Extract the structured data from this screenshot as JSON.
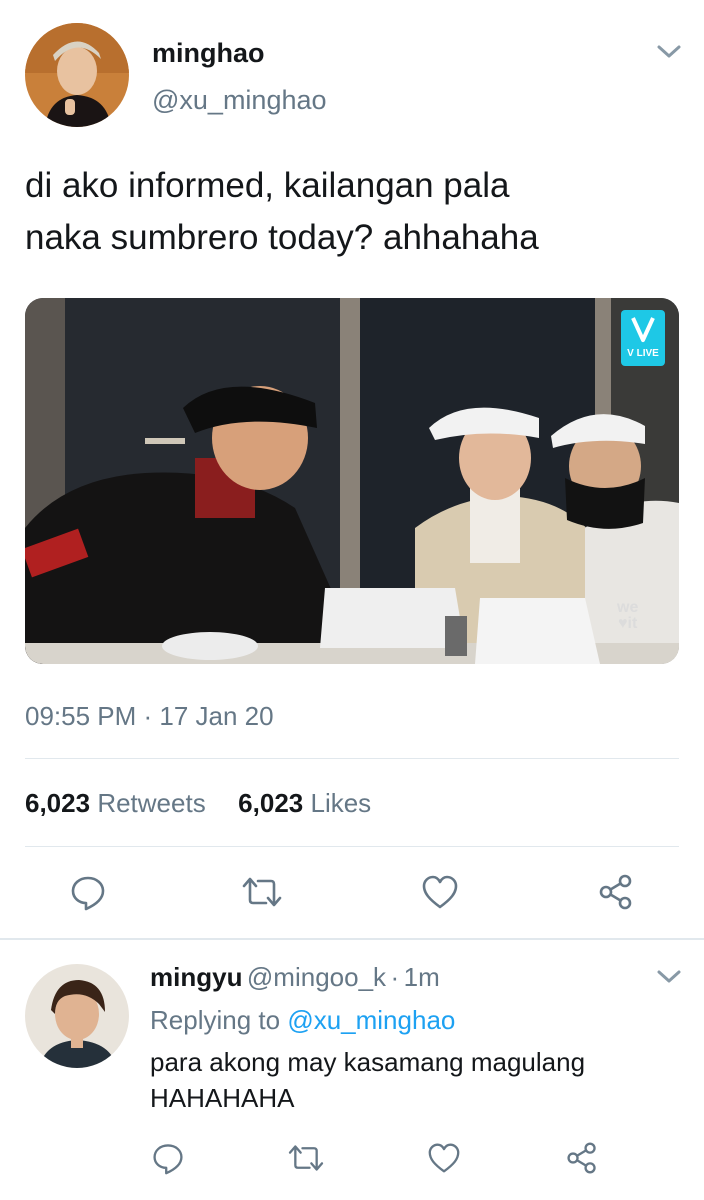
{
  "tweet": {
    "display_name": "minghao",
    "handle": "@xu_minghao",
    "text_line1": "di ako informed, kailangan pala",
    "text_line2": "naka sumbrero today? ahhahaha",
    "timestamp": "09:55 PM · 17 Jan 20",
    "retweets_count": "6,023",
    "retweets_label": "Retweets",
    "likes_count": "6,023",
    "likes_label": "Likes",
    "media_badge": "V LIVE",
    "media_watermark_line1": "we",
    "media_watermark_line2": "♥it"
  },
  "reply": {
    "display_name": "mingyu",
    "handle": "@mingoo_k",
    "separator": "·",
    "time": "1m",
    "replying_to_label": "Replying to",
    "replying_to_handle": "@xu_minghao",
    "text_line1": "para akong may kasamang magulang",
    "text_line2": "HAHAHAHA"
  },
  "icons": {
    "reply": "reply-icon",
    "retweet": "retweet-icon",
    "like": "heart-icon",
    "share": "share-icon",
    "more": "chevron-down-icon"
  },
  "colors": {
    "accent": "#1da1f2",
    "secondary_text": "#657786",
    "divider": "#e1e8ed"
  }
}
